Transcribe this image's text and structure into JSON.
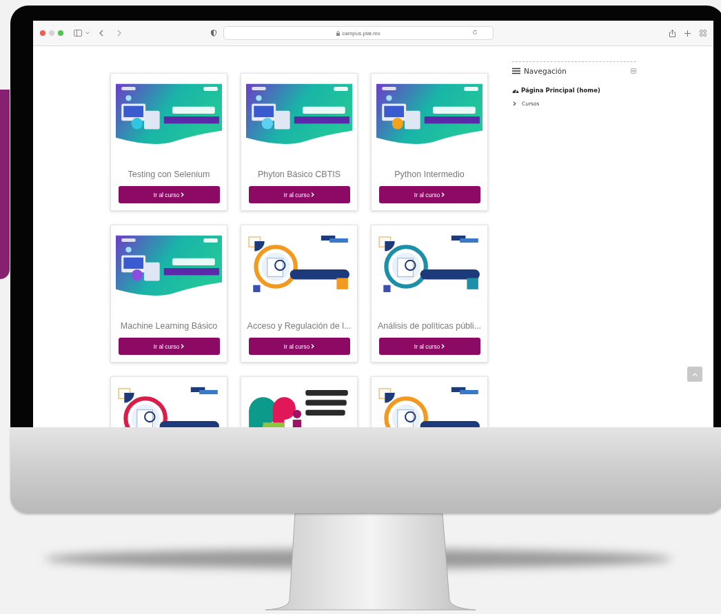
{
  "browser": {
    "url": "campus.plai.mx"
  },
  "courses": [
    {
      "image": {
        "kind": "picture"
      },
      "title": "Testing con Selenium",
      "button": "Ir al curso"
    },
    {
      "image": {
        "kind": "picture"
      },
      "title": "Phyton Básico CBTIS",
      "button": "Ir al curso"
    },
    {
      "image": {
        "kind": "picture"
      },
      "title": "Python Intermedio",
      "button": "Ir al curso"
    },
    {
      "image": {
        "kind": "picture"
      },
      "title": "Machine Learning Básico",
      "button": "Ir al curso"
    },
    {
      "image": {
        "kind": "picture"
      },
      "title": "Acceso y Regulación de l...",
      "button": "Ir al curso"
    },
    {
      "image": {
        "kind": "picture"
      },
      "title": "Análisis de políticas públi...",
      "button": "Ir al curso"
    },
    {
      "image": {
        "kind": "picture"
      }
    },
    {
      "image": {
        "kind": "picture"
      }
    },
    {
      "image": {
        "kind": "picture"
      }
    }
  ],
  "navigation": {
    "title": "Navegación",
    "items": [
      {
        "kind": "home",
        "label": "Página Principal (home)"
      },
      {
        "kind": "branch",
        "label": "Cursos",
        "expanded": false
      }
    ]
  }
}
